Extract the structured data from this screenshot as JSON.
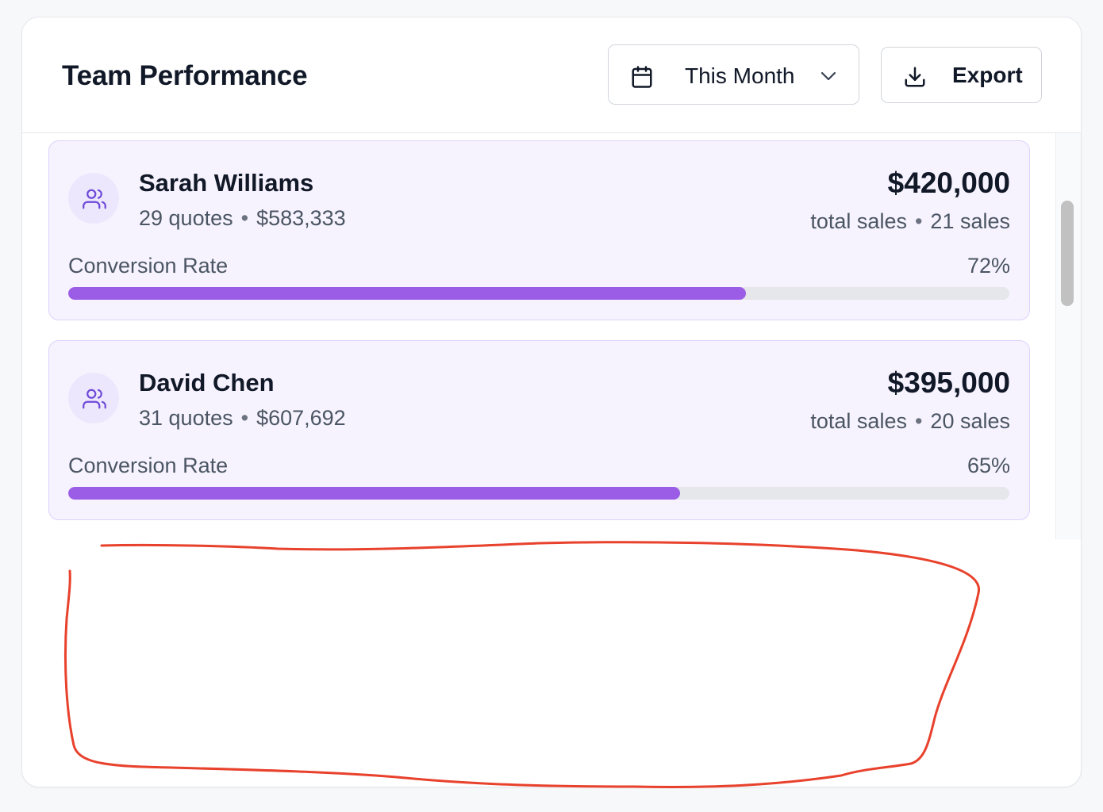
{
  "header": {
    "title": "Team Performance",
    "period": {
      "label": "This Month",
      "icon": "calendar-icon"
    },
    "export": {
      "label": "Export",
      "icon": "download-icon"
    }
  },
  "members": [
    {
      "name": "Sarah Williams",
      "quotes": "29 quotes",
      "quote_value": "$583,333",
      "total_sales": "$420,000",
      "total_sales_label": "total sales",
      "sales_count": "21 sales",
      "conversion_label": "Conversion Rate",
      "conversion_pct": "72%",
      "conversion_value": 0.72
    },
    {
      "name": "David Chen",
      "quotes": "31 quotes",
      "quote_value": "$607,692",
      "total_sales": "$395,000",
      "total_sales_label": "total sales",
      "sales_count": "20 sales",
      "conversion_label": "Conversion Rate",
      "conversion_pct": "65%",
      "conversion_value": 0.65
    }
  ],
  "colors": {
    "accent": "#9b5de5",
    "card_bg": "#f6f3fe",
    "card_border": "#ddd2fb",
    "annotation": "#e8412c"
  }
}
